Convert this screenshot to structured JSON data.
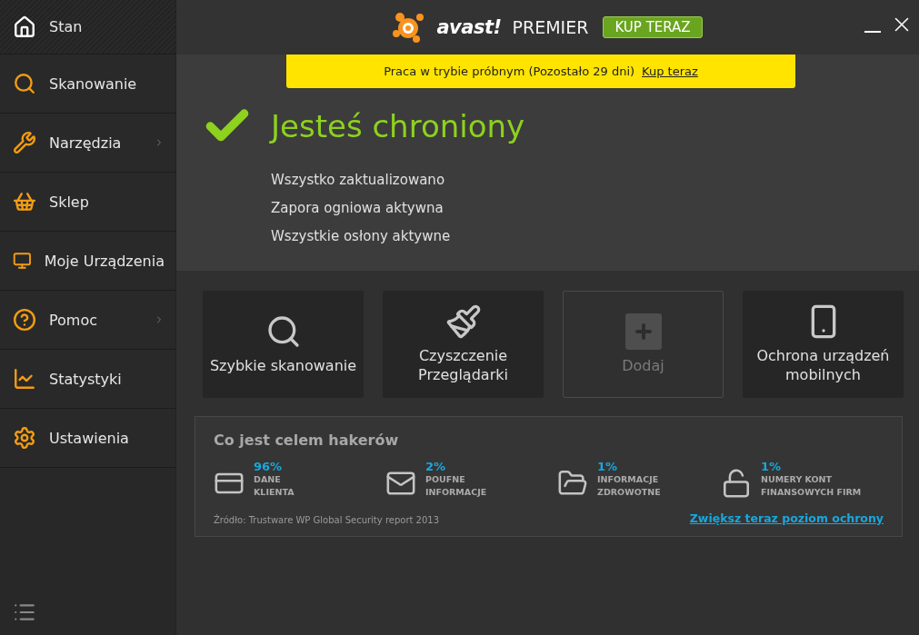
{
  "sidebar": {
    "items": [
      {
        "label": "Stan",
        "kind": "home",
        "selected": true,
        "submenu": false
      },
      {
        "label": "Skanowanie",
        "kind": "scan",
        "selected": false,
        "submenu": false
      },
      {
        "label": "Narzędzia",
        "kind": "tools",
        "selected": false,
        "submenu": true
      },
      {
        "label": "Sklep",
        "kind": "shop",
        "selected": false,
        "submenu": false
      },
      {
        "label": "Moje Urządzenia",
        "kind": "devices",
        "selected": false,
        "submenu": false
      },
      {
        "label": "Pomoc",
        "kind": "help",
        "selected": false,
        "submenu": true
      },
      {
        "label": "Statystyki",
        "kind": "stats",
        "selected": false,
        "submenu": false
      },
      {
        "label": "Ustawienia",
        "kind": "settings",
        "selected": false,
        "submenu": false
      }
    ]
  },
  "header": {
    "logo_text": "avast!",
    "edition": "PREMIER",
    "buy_button": "KUP TERAZ"
  },
  "trial_banner": {
    "text": "Praca w trybie próbnym (Pozostało 29 dni)",
    "link": "Kup teraz"
  },
  "status": {
    "title": "Jesteś chroniony",
    "lines": [
      "Wszystko zaktualizowano",
      "Zapora ogniowa aktywna",
      "Wszystkie osłony aktywne"
    ]
  },
  "tiles": [
    {
      "label": "Szybkie skanowanie",
      "kind": "scan"
    },
    {
      "label": "Czyszczenie Przeglądarki",
      "kind": "browser"
    },
    {
      "label": "Dodaj",
      "kind": "add"
    },
    {
      "label": "Ochrona urządzeń mobilnych",
      "kind": "mobile"
    }
  ],
  "hackers": {
    "title": "Co jest celem hakerów",
    "items": [
      {
        "percent": "96%",
        "label": [
          "DANE",
          "KLIENTA"
        ],
        "kind": "card"
      },
      {
        "percent": "2%",
        "label": [
          "POUFNE",
          "INFORMACJE"
        ],
        "kind": "mail"
      },
      {
        "percent": "1%",
        "label": [
          "INFORMACJE",
          "ZDROWOTNE"
        ],
        "kind": "folder"
      },
      {
        "percent": "1%",
        "label": [
          "NUMERY KONT",
          "FINANSOWYCH FIRM"
        ],
        "kind": "lock"
      }
    ],
    "source": "Źródło: Trustware WP Global Security report 2013",
    "link": "Zwiększ teraz poziom ochrony"
  }
}
